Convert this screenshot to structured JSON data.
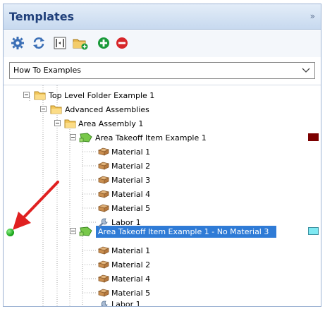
{
  "panel": {
    "title": "Templates",
    "collapse_glyph": "»"
  },
  "toolbar": {
    "buttons": [
      {
        "name": "settings",
        "icon": "gear-icon"
      },
      {
        "name": "refresh",
        "icon": "refresh-icon"
      },
      {
        "name": "fit",
        "icon": "fit-columns-icon"
      },
      {
        "name": "new-folder",
        "icon": "folder-add-icon"
      },
      {
        "name": "add",
        "icon": "plus-circle-icon",
        "color": "#1a9a3a"
      },
      {
        "name": "remove",
        "icon": "minus-circle-icon",
        "color": "#d7262a"
      }
    ]
  },
  "combo": {
    "value": "How To Examples"
  },
  "tree": {
    "nodes": [
      {
        "label": "Top Level Folder Example 1",
        "type": "folder",
        "expanded": true
      },
      {
        "label": "Advanced Assemblies",
        "type": "folder",
        "expanded": true
      },
      {
        "label": "Area Assembly 1",
        "type": "folder",
        "expanded": true
      },
      {
        "label": "Area Takeoff Item Example 1",
        "type": "takeoff-item",
        "expanded": true,
        "swatch_color": "#7b0000"
      },
      {
        "label": "Material 1",
        "type": "material"
      },
      {
        "label": "Material 2",
        "type": "material"
      },
      {
        "label": "Material 3",
        "type": "material"
      },
      {
        "label": "Material 4",
        "type": "material"
      },
      {
        "label": "Material 5",
        "type": "material"
      },
      {
        "label": "Labor 1",
        "type": "labor"
      },
      {
        "label": "Area Takeoff Item Example 1 - No Material 3",
        "type": "takeoff-item",
        "expanded": true,
        "selected": true,
        "swatch_color": "#7fe9f2"
      },
      {
        "label": "Material 1",
        "type": "material"
      },
      {
        "label": "Material 2",
        "type": "material"
      },
      {
        "label": "Material 4",
        "type": "material"
      },
      {
        "label": "Material 5",
        "type": "material"
      },
      {
        "label": "Labor 1",
        "type": "labor"
      }
    ]
  },
  "annotation": {
    "arrow_color": "#e02020",
    "indicator_color": "#16a316"
  }
}
